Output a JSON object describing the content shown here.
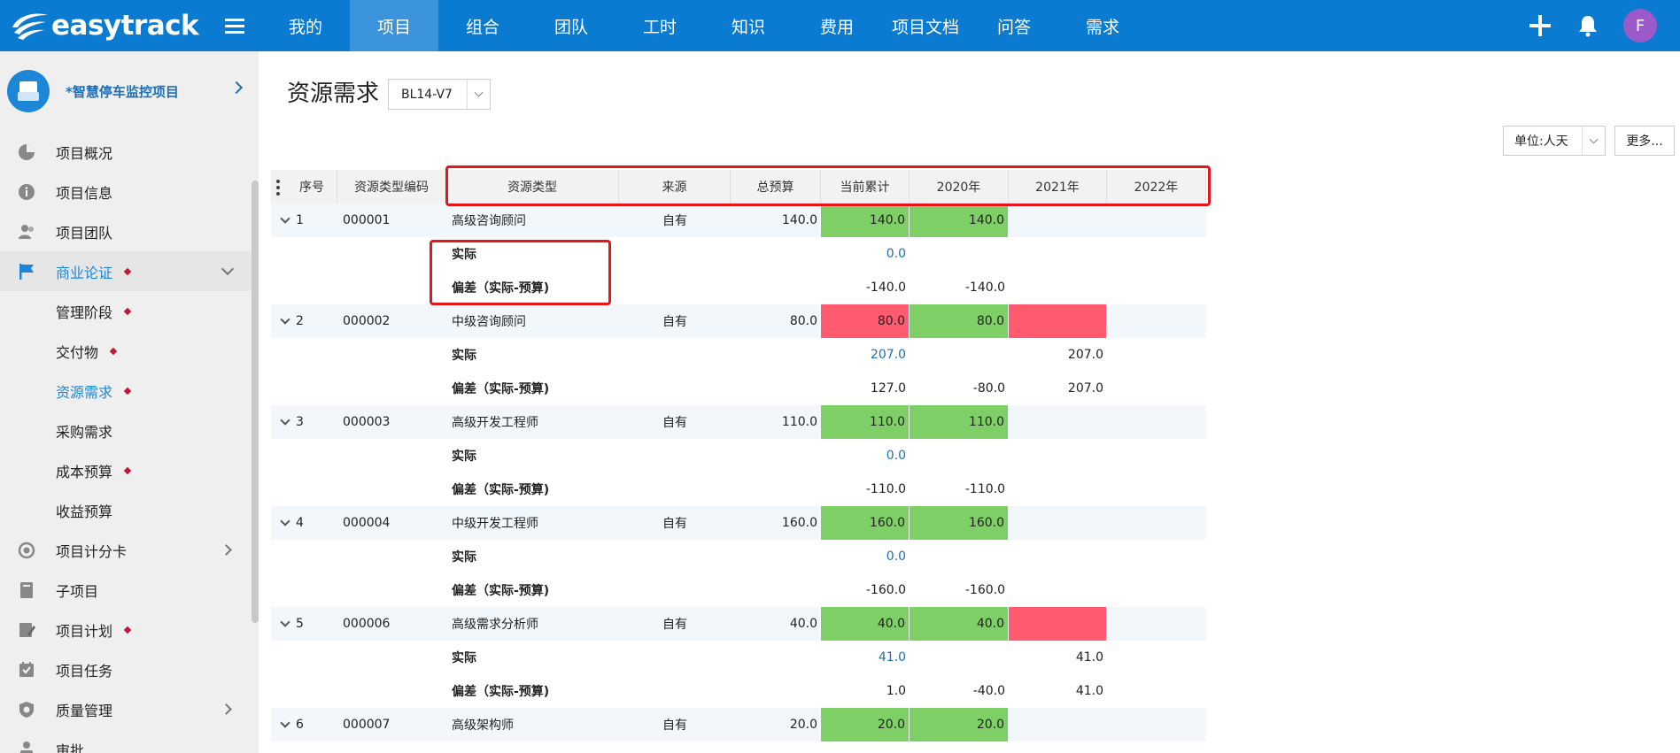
{
  "topbar": {
    "logo_text": "easytrack",
    "nav": [
      "我的",
      "项目",
      "组合",
      "团队",
      "工时",
      "知识",
      "费用",
      "项目文档",
      "问答",
      "需求"
    ],
    "active_nav_index": 1,
    "avatar_letter": "F"
  },
  "sidebar": {
    "project_name": "*智慧停车监控项目",
    "items": [
      {
        "label": "项目概况",
        "icon": "pie-chart-icon"
      },
      {
        "label": "项目信息",
        "icon": "info-icon"
      },
      {
        "label": "项目团队",
        "icon": "team-icon"
      },
      {
        "label": "商业论证",
        "icon": "flag-icon",
        "diamond": true,
        "expanded": true
      },
      {
        "label": "管理阶段",
        "sub": true,
        "diamond": true
      },
      {
        "label": "交付物",
        "sub": true,
        "diamond": true
      },
      {
        "label": "资源需求",
        "sub": true,
        "diamond": true,
        "current": true
      },
      {
        "label": "采购需求",
        "sub": true
      },
      {
        "label": "成本预算",
        "sub": true,
        "diamond": true
      },
      {
        "label": "收益预算",
        "sub": true
      },
      {
        "label": "项目计分卡",
        "icon": "target-icon",
        "chevron": true
      },
      {
        "label": "子项目",
        "icon": "book-icon"
      },
      {
        "label": "项目计划",
        "icon": "plan-icon",
        "diamond": true
      },
      {
        "label": "项目任务",
        "icon": "task-icon"
      },
      {
        "label": "质量管理",
        "icon": "shield-icon",
        "chevron": true
      },
      {
        "label": "审批",
        "icon": "approve-icon"
      }
    ]
  },
  "main": {
    "title": "资源需求",
    "version": "BL14-V7",
    "unit": "单位:人天",
    "more": "更多..."
  },
  "table": {
    "headers": [
      "序号",
      "资源类型编码",
      "资源类型",
      "来源",
      "总预算",
      "当前累计",
      "2020年",
      "2021年",
      "2022年"
    ],
    "groups": [
      {
        "no": "1",
        "code": "000001",
        "type": "高级咨询顾问",
        "source": "自有",
        "budget": "140.0",
        "current": "140.0",
        "y2020": "140.0",
        "y2021": "",
        "y2022": "",
        "current_color": "green",
        "y2020_color": "green",
        "y2021_color": "",
        "actual": {
          "label": "实际",
          "current": "0.0",
          "y2020": "",
          "y2021": ""
        },
        "variance": {
          "label": "偏差（实际-预算)",
          "current": "-140.0",
          "y2020": "-140.0",
          "y2021": ""
        }
      },
      {
        "no": "2",
        "code": "000002",
        "type": "中级咨询顾问",
        "source": "自有",
        "budget": "80.0",
        "current": "80.0",
        "y2020": "80.0",
        "y2021": "",
        "y2022": "",
        "current_color": "red",
        "y2020_color": "green",
        "y2021_color": "red",
        "actual": {
          "label": "实际",
          "current": "207.0",
          "y2020": "",
          "y2021": "207.0"
        },
        "variance": {
          "label": "偏差（实际-预算)",
          "current": "127.0",
          "y2020": "-80.0",
          "y2021": "207.0"
        }
      },
      {
        "no": "3",
        "code": "000003",
        "type": "高级开发工程师",
        "source": "自有",
        "budget": "110.0",
        "current": "110.0",
        "y2020": "110.0",
        "y2021": "",
        "y2022": "",
        "current_color": "green",
        "y2020_color": "green",
        "y2021_color": "",
        "actual": {
          "label": "实际",
          "current": "0.0",
          "y2020": "",
          "y2021": ""
        },
        "variance": {
          "label": "偏差（实际-预算)",
          "current": "-110.0",
          "y2020": "-110.0",
          "y2021": ""
        }
      },
      {
        "no": "4",
        "code": "000004",
        "type": "中级开发工程师",
        "source": "自有",
        "budget": "160.0",
        "current": "160.0",
        "y2020": "160.0",
        "y2021": "",
        "y2022": "",
        "current_color": "green",
        "y2020_color": "green",
        "y2021_color": "",
        "actual": {
          "label": "实际",
          "current": "0.0",
          "y2020": "",
          "y2021": ""
        },
        "variance": {
          "label": "偏差（实际-预算)",
          "current": "-160.0",
          "y2020": "-160.0",
          "y2021": ""
        }
      },
      {
        "no": "5",
        "code": "000006",
        "type": "高级需求分析师",
        "source": "自有",
        "budget": "40.0",
        "current": "40.0",
        "y2020": "40.0",
        "y2021": "",
        "y2022": "",
        "current_color": "green",
        "y2020_color": "green",
        "y2021_color": "red",
        "actual": {
          "label": "实际",
          "current": "41.0",
          "y2020": "",
          "y2021": "41.0"
        },
        "variance": {
          "label": "偏差（实际-预算)",
          "current": "1.0",
          "y2020": "-40.0",
          "y2021": "41.0"
        }
      },
      {
        "no": "6",
        "code": "000007",
        "type": "高级架构师",
        "source": "自有",
        "budget": "20.0",
        "current": "20.0",
        "y2020": "20.0",
        "y2021": "",
        "y2022": "",
        "current_color": "green",
        "y2020_color": "green",
        "y2021_color": ""
      }
    ]
  },
  "colors": {
    "brand_blue": "#0b7ad1",
    "green_cell": "#7ed066",
    "red_cell": "#ff5a70",
    "highlight_red": "#e8141c"
  }
}
